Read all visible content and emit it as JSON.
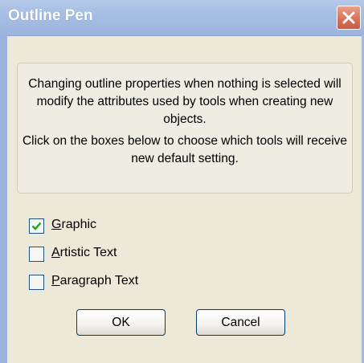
{
  "window": {
    "title": "Outline Pen"
  },
  "message": {
    "paragraph1": "Changing outline properties when nothing is selected will modify the attributes used by tools when creating new objects.",
    "paragraph2": "Click on the boxes below to choose which tools will receive new default setting."
  },
  "options": [
    {
      "mnemonic": "G",
      "rest": "raphic",
      "checked": true
    },
    {
      "mnemonic": "A",
      "rest": "rtistic Text",
      "checked": false
    },
    {
      "mnemonic": "P",
      "rest": "aragraph Text",
      "checked": false
    }
  ],
  "buttons": {
    "ok": "OK",
    "cancel": "Cancel"
  },
  "icons": {
    "close": "close-icon",
    "check": "checkmark-icon"
  },
  "colors": {
    "titlebar": "#a6bde3",
    "close_button": "#d9735a",
    "checkmark": "#21a121",
    "background": "#ece9d8"
  }
}
